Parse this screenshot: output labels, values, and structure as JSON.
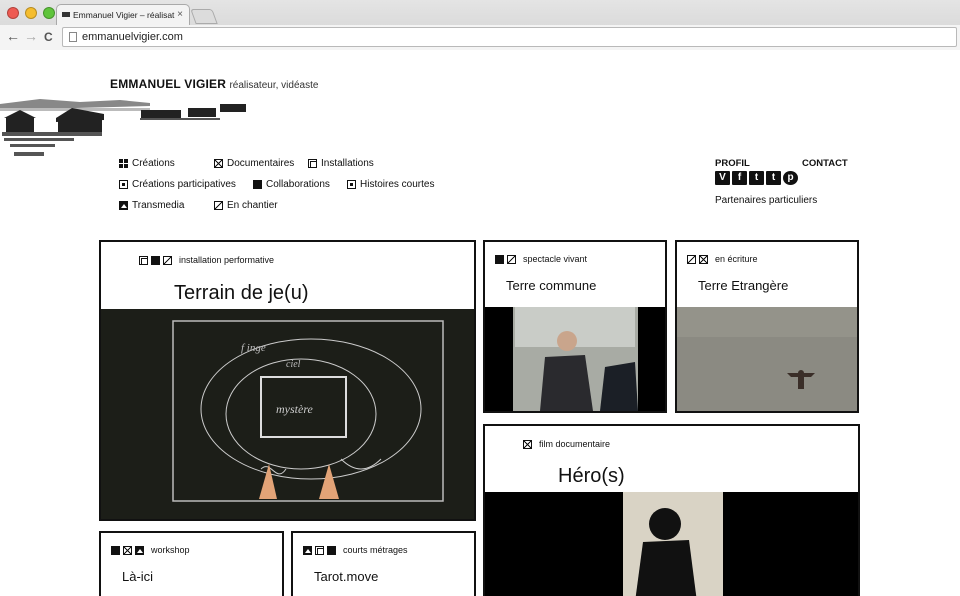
{
  "browser": {
    "tab_title": "Emmanuel Vigier – réalisat",
    "tab_close": "×",
    "url": "emmanuelvigier.com",
    "back": "←",
    "forward": "→",
    "reload": "C"
  },
  "site": {
    "name": "EMMANUEL VIGIER",
    "tagline": "réalisateur, vidéaste"
  },
  "menu": {
    "creations": "Créations",
    "documentaires": "Documentaires",
    "installations": "Installations",
    "participatives": "Créations participatives",
    "collaborations": "Collaborations",
    "histoires": "Histoires courtes",
    "transmedia": "Transmedia",
    "chantier": "En chantier"
  },
  "right": {
    "profil": "PROFIL",
    "contact": "CONTACT",
    "partners": "Partenaires particuliers",
    "social": [
      "V",
      "f",
      "t",
      "t",
      "p"
    ]
  },
  "cards": {
    "terrain": {
      "category": "installation performative",
      "title": "Terrain de je(u)"
    },
    "terre_commune": {
      "category": "spectacle vivant",
      "title": "Terre commune"
    },
    "terre_etrangere": {
      "category": "en écriture",
      "title": "Terre Etrangère"
    },
    "heros": {
      "category": "film documentaire",
      "title": "Héro(s)"
    },
    "la_ici": {
      "category": "workshop",
      "title": "Là-ici"
    },
    "tarot": {
      "category": "courts métrages",
      "title": "Tarot.move"
    }
  }
}
